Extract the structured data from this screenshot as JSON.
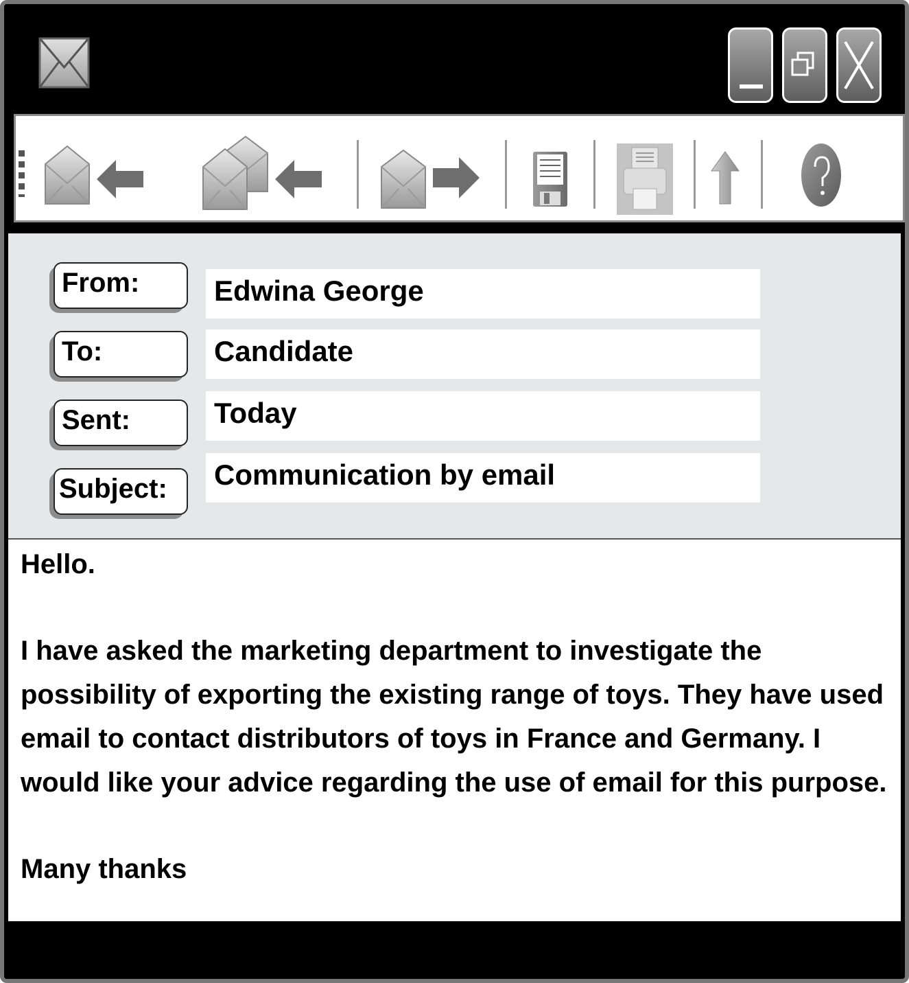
{
  "window": {
    "app_icon": "envelope-icon",
    "controls": [
      "minimize-icon",
      "restore-icon",
      "close-icon"
    ]
  },
  "toolbar": {
    "items": [
      "reply-icon",
      "reply-all-icon",
      "forward-icon",
      "save-icon",
      "print-icon",
      "upload-icon",
      "help-icon"
    ]
  },
  "header": {
    "from_label": "From:",
    "from_value": "Edwina George",
    "to_label": "To:",
    "to_value": "Candidate",
    "sent_label": "Sent:",
    "sent_value": "Today",
    "subject_label": "Subject:",
    "subject_value": "Communication by email"
  },
  "message": {
    "greeting": "Hello.",
    "body": "I have asked the marketing department to investigate the possibility of exporting the existing range of toys. They have used email to contact distributors of toys in France and Germany. I would like your advice regarding the use of email for this purpose.",
    "closing": "Many thanks"
  }
}
